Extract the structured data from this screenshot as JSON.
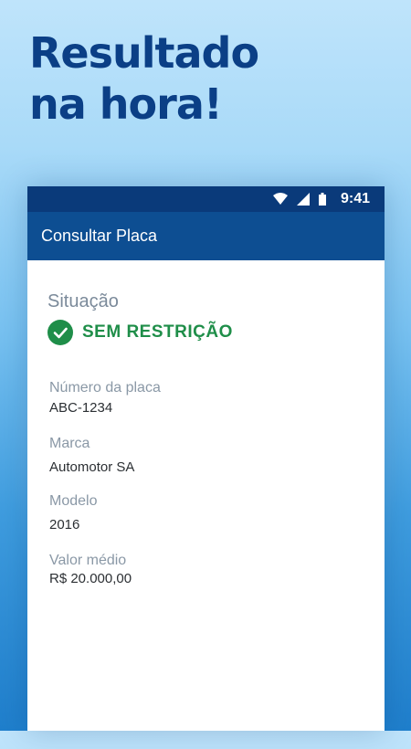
{
  "headline": {
    "line1": "Resultado",
    "line2": "na hora!"
  },
  "status_bar": {
    "time": "9:41",
    "icons": [
      "wifi-icon",
      "cell-signal-icon",
      "battery-icon"
    ]
  },
  "app_bar": {
    "title": "Consultar Placa"
  },
  "situacao": {
    "label": "Situação",
    "status": "SEM RESTRIÇÃO",
    "status_color": "#1f8e49",
    "icon": "check-circle-icon"
  },
  "fields": [
    {
      "label": "Número da placa",
      "value": "ABC-1234"
    },
    {
      "label": "Marca",
      "value": "Automotor SA"
    },
    {
      "label": "Modelo",
      "value": "2016"
    },
    {
      "label": "Valor médio",
      "value": "R$ 20.000,00"
    }
  ],
  "colors": {
    "headline": "#0b3f86",
    "status_bar": "#0a3a7a",
    "app_bar": "#0d4e92"
  }
}
